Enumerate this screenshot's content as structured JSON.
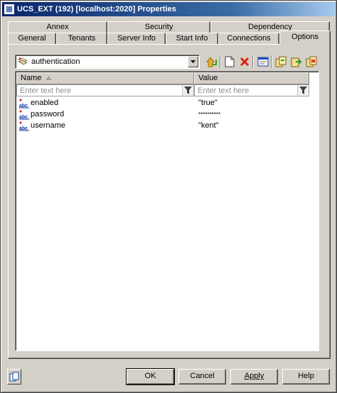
{
  "window": {
    "title": "UCS_EXT (192) [localhost:2020] Properties"
  },
  "tabs": {
    "row1": [
      {
        "label": "Annex"
      },
      {
        "label": "Security"
      },
      {
        "label": "Dependency"
      }
    ],
    "row2": [
      {
        "label": "General"
      },
      {
        "label": "Tenants"
      },
      {
        "label": "Server Info"
      },
      {
        "label": "Start Info"
      },
      {
        "label": "Connections"
      },
      {
        "label": "Options"
      }
    ],
    "active": "Options"
  },
  "section_selector": {
    "value": "authentication"
  },
  "grid": {
    "columns": [
      "Name",
      "Value"
    ],
    "filter_placeholder": "Enter text here",
    "rows": [
      {
        "name": "enabled",
        "value": "\"true\""
      },
      {
        "name": "password",
        "value": "**********"
      },
      {
        "name": "username",
        "value": "\"kent\""
      }
    ]
  },
  "buttons": {
    "ok": "OK",
    "cancel": "Cancel",
    "apply": "Apply",
    "help": "Help"
  },
  "colors": {
    "titlebar_start": "#0a246a",
    "titlebar_end": "#a6caf0",
    "face": "#d4d0c8"
  }
}
